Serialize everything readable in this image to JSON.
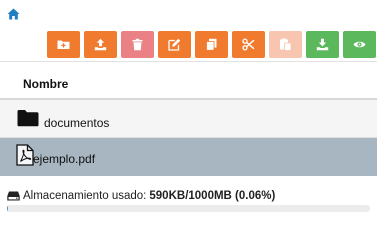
{
  "toolbar": {
    "buttons": [
      {
        "icon": "new-folder-icon",
        "color": "#f07a2e"
      },
      {
        "icon": "upload-icon",
        "color": "#f07a2e"
      },
      {
        "icon": "trash-icon",
        "color": "#ea8285"
      },
      {
        "icon": "edit-icon",
        "color": "#f07a2e"
      },
      {
        "icon": "copy-icon",
        "color": "#f07a2e"
      },
      {
        "icon": "cut-icon",
        "color": "#f07a2e"
      },
      {
        "icon": "paste-icon",
        "color": "#f7c5b0"
      },
      {
        "icon": "download-icon",
        "color": "#5cb85c"
      },
      {
        "icon": "view-icon",
        "color": "#5cb85c"
      }
    ]
  },
  "table": {
    "header": "Nombre",
    "rows": [
      {
        "name": "documentos",
        "icon": "folder-icon",
        "selected": false
      },
      {
        "name": "ejemplo.pdf",
        "icon": "pdf-file-icon",
        "selected": true
      }
    ]
  },
  "storage": {
    "label": "Almacenamiento usado:",
    "value": "590KB/1000MB (0.06%)",
    "percent": 0.06
  },
  "colors": {
    "accent": "#1f7fc1",
    "selected_row": "#a7b6c0",
    "progress_fill": "#5b8db8"
  }
}
